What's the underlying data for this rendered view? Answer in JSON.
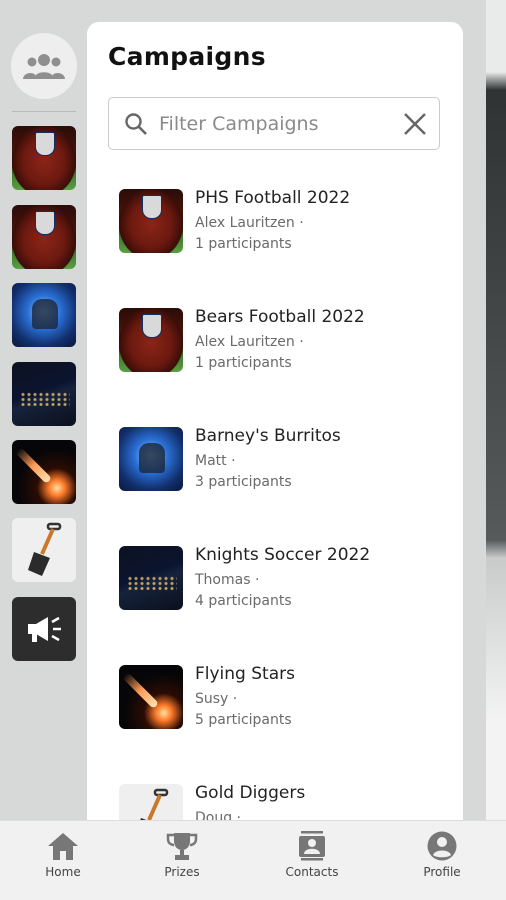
{
  "header": {
    "title": "Campaigns"
  },
  "search": {
    "placeholder": "Filter Campaigns",
    "value": ""
  },
  "rail": {
    "items": [
      {
        "icon": "group-icon"
      },
      {
        "thumb": "football"
      },
      {
        "thumb": "football"
      },
      {
        "thumb": "blue-burst"
      },
      {
        "thumb": "night-earth"
      },
      {
        "thumb": "comet"
      },
      {
        "thumb": "shovel"
      },
      {
        "thumb": "megaphone"
      }
    ]
  },
  "campaigns": [
    {
      "name": "PHS Football 2022",
      "owner": "Alex Lauritzen ·",
      "participants": "1 participants",
      "thumb": "football"
    },
    {
      "name": "Bears Football 2022",
      "owner": "Alex Lauritzen ·",
      "participants": "1 participants",
      "thumb": "football"
    },
    {
      "name": "Barney's Burritos",
      "owner": "Matt ·",
      "participants": "3 participants",
      "thumb": "blue-burst"
    },
    {
      "name": "Knights Soccer 2022",
      "owner": "Thomas ·",
      "participants": "4 participants",
      "thumb": "night-earth"
    },
    {
      "name": "Flying Stars",
      "owner": "Susy ·",
      "participants": "5 participants",
      "thumb": "comet"
    },
    {
      "name": "Gold Diggers",
      "owner": "Doug ·",
      "participants": "",
      "thumb": "shovel"
    }
  ],
  "bottom_nav": [
    {
      "label": "Home",
      "icon": "home-icon"
    },
    {
      "label": "Prizes",
      "icon": "trophy-icon"
    },
    {
      "label": "Contacts",
      "icon": "contacts-icon"
    },
    {
      "label": "Profile",
      "icon": "profile-icon"
    }
  ],
  "colors": {
    "panel": "#ffffff",
    "drawer": "#d7d9d8",
    "nav": "#f1f1f1",
    "text": "#222222",
    "muted": "#6a6a6a"
  }
}
